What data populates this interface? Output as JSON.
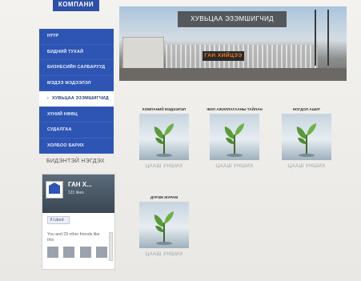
{
  "header": {
    "logo_text": "КОМПАНИ"
  },
  "sidebar": {
    "items": [
      {
        "label": "НҮҮР"
      },
      {
        "label": "БИДНИЙ ТУХАЙ"
      },
      {
        "label": "БИЗНЕСИЙН САЛБАРУУД"
      },
      {
        "label": "МЭДЭЭ МЭДЭЭЛЭЛ"
      },
      {
        "label": "ХУВЬЦАА ЭЗЭМШИГЧИД",
        "active": true
      },
      {
        "label": "ХҮНИЙ НӨӨЦ"
      },
      {
        "label": "СУДАЛГАА"
      },
      {
        "label": "ХОЛБОО БАРИХ"
      }
    ],
    "partner_heading": "БИДЭНТЭЙ НЭГДЭХ"
  },
  "facebook": {
    "page_name": "ГАН Х...",
    "likes": "121 likes",
    "like_button": "Liked",
    "friends_text": "You and 29 other friends like this"
  },
  "banner": {
    "title": "ХУВЬЦАА ЭЗЭМШИГЧИД",
    "sign_text": "ГАН ХИЙЦЭЭ"
  },
  "cards": [
    {
      "title": "КОМПАНИЙ МЭДЭЭЛЭЛ",
      "label": "ЦААШ УНШИХ"
    },
    {
      "title": "ЖИЛ АЖИЛЛАГААНЫ ТАЙЛАН",
      "label": "ЦААШ УНШИХ"
    },
    {
      "title": "НОГДОЛ АШИГ",
      "label": "ЦААШ УНШИХ"
    },
    {
      "title": "ДҮРЭМ ЖУРАМ",
      "label": "ЦААШ УНШИХ"
    }
  ],
  "colors": {
    "nav_bg": "#2e55b3",
    "nav_active_bg": "#ffffff",
    "banner_title_bg": "#3a3a3a"
  },
  "icons": {
    "card_image": "plant-sprout-icon",
    "like_button": "facebook-f-icon"
  }
}
